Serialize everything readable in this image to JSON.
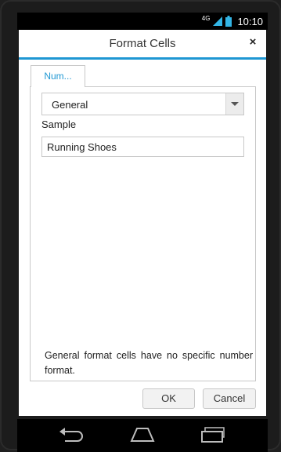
{
  "status_bar": {
    "network": "4G",
    "time": "10:10"
  },
  "dialog": {
    "title": "Format Cells",
    "close_symbol": "×",
    "tabs": [
      {
        "label": "Num..."
      }
    ],
    "category_select": {
      "value": "General"
    },
    "sample": {
      "label": "Sample",
      "value": "Running Shoes"
    },
    "description": "General format cells have no specific number format.",
    "buttons": {
      "ok": "OK",
      "cancel": "Cancel"
    }
  },
  "colors": {
    "accent": "#1e97d3",
    "status_bar": "#000000",
    "dialog_bg": "#ffffff",
    "button_bg": "#f2f2f2"
  },
  "nav": {
    "icons": [
      "back-icon",
      "home-icon",
      "recents-icon"
    ]
  }
}
